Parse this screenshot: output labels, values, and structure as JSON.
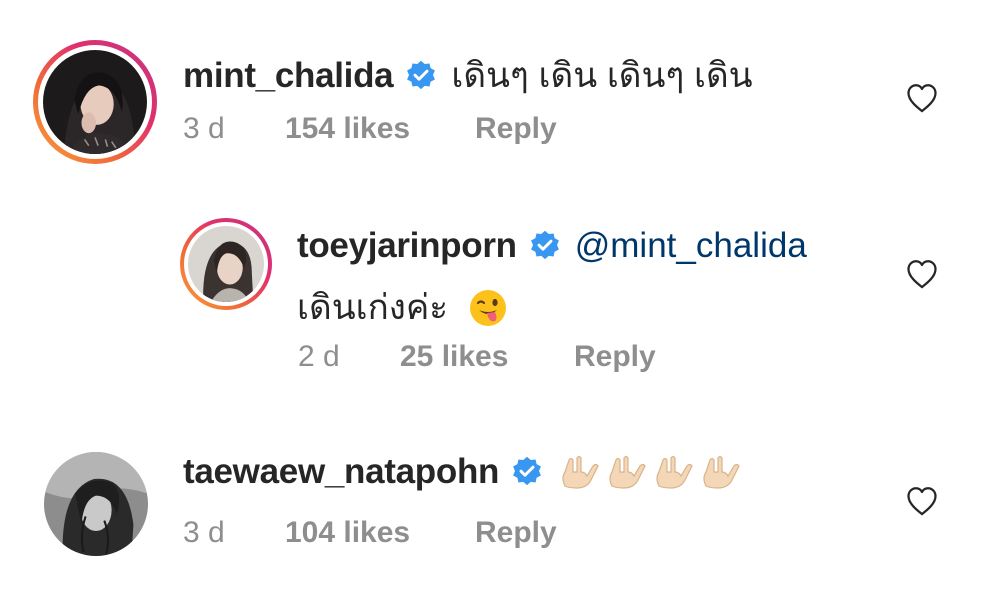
{
  "comments": [
    {
      "username": "mint_chalida",
      "text": "เดินๆ เดิน เดินๆ เดิน",
      "time": "3 d",
      "likes": "154 likes",
      "reply": "Reply",
      "avatar_icon": "person-photo-avatar",
      "has_story_ring": true
    },
    {
      "username": "toeyjarinporn",
      "mention": "@mint_chalida",
      "text": "เดินเก่งค่ะ",
      "emoji": "winking-face-with-tongue",
      "time": "2 d",
      "likes": "25 likes",
      "reply": "Reply",
      "avatar_icon": "person-photo-avatar",
      "has_story_ring": true
    },
    {
      "username": "taewaew_natapohn",
      "emoji": "love-you-gesture-x4",
      "time": "3 d",
      "likes": "104 likes",
      "reply": "Reply",
      "avatar_icon": "person-photo-avatar",
      "has_story_ring": false
    }
  ],
  "icons": {
    "verified": "verified-badge-icon",
    "like": "heart-outline-icon"
  },
  "colors": {
    "verified_blue": "#3897f0",
    "mention": "#00376b",
    "meta_gray": "#8e8e8e",
    "username": "#262626"
  }
}
